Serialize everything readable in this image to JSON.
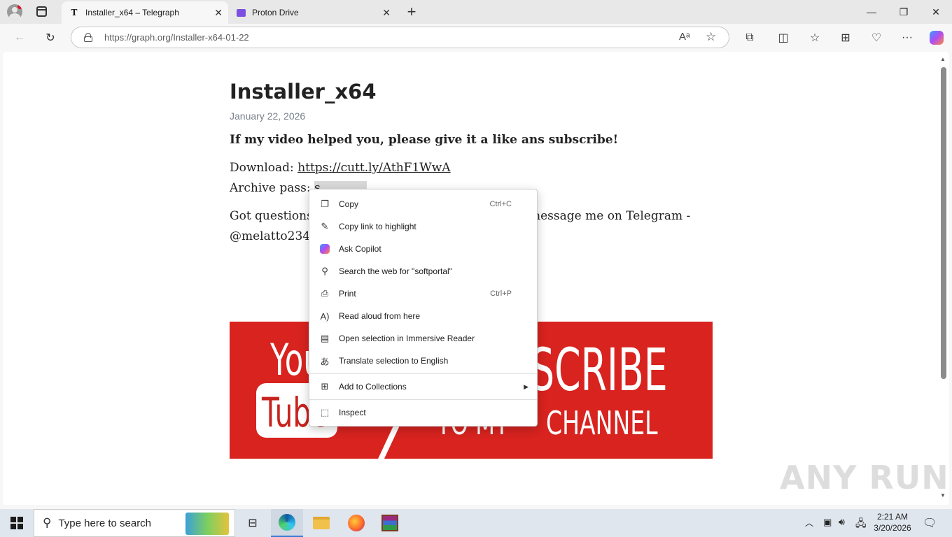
{
  "browser": {
    "tabs": [
      {
        "label": "Installer_x64 – Telegraph",
        "favicon": "T"
      },
      {
        "label": "Proton Drive"
      }
    ],
    "url": "https://graph.org/Installer-x64-01-22"
  },
  "article": {
    "title": "Installer_x64",
    "date": "January 22, 2026",
    "headline": "If my video helped you, please give it a like ans subscribe!",
    "download_label": "Download: ",
    "download_link": "https://cutt.ly/AthF1WwA",
    "archive_label": "Archive pass: ",
    "archive_pass_visible": "s",
    "questions_start": "Got questions",
    "questions_end": "message me on Telegram -",
    "telegram_handle": "@melatto234"
  },
  "banner": {
    "text_you": "You",
    "text_tube": "Tube",
    "text_scribe": "SCRIBE",
    "text_channel": "CHANNEL",
    "text_tomy": "TO MY"
  },
  "context_menu": {
    "items": [
      {
        "label": "Copy",
        "shortcut": "Ctrl+C",
        "icon": "copy-icon"
      },
      {
        "label": "Copy link to highlight",
        "icon": "link-highlight-icon"
      },
      {
        "label": "Ask Copilot",
        "icon": "copilot-icon"
      },
      {
        "label": "Search the web for \"softportal\"",
        "icon": "search-icon"
      },
      {
        "label": "Print",
        "shortcut": "Ctrl+P",
        "icon": "print-icon"
      },
      {
        "label": "Read aloud from here",
        "icon": "read-aloud-icon"
      },
      {
        "label": "Open selection in Immersive Reader",
        "icon": "immersive-reader-icon"
      },
      {
        "label": "Translate selection to English",
        "icon": "translate-icon"
      },
      {
        "label": "Add to Collections",
        "icon": "collections-icon"
      },
      {
        "label": "Inspect",
        "icon": "inspect-icon"
      }
    ]
  },
  "taskbar": {
    "search_placeholder": "Type here to search",
    "time": "2:21 AM",
    "date": "3/20/2026"
  },
  "watermark": "ANY RUN"
}
